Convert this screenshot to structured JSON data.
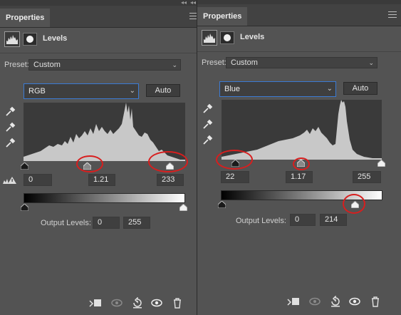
{
  "left_panel": {
    "tab_title": "Properties",
    "adjustment_title": "Levels",
    "preset_label": "Preset:",
    "preset_value": "Custom",
    "channel_value": "RGB",
    "auto_label": "Auto",
    "input_black": "0",
    "input_gamma": "1.21",
    "input_white": "233",
    "output_label": "Output Levels:",
    "output_black": "0",
    "output_white": "255"
  },
  "right_panel": {
    "tab_title": "Properties",
    "adjustment_title": "Levels",
    "preset_label": "Preset:",
    "preset_value": "Custom",
    "channel_value": "Blue",
    "auto_label": "Auto",
    "input_black": "22",
    "input_gamma": "1.17",
    "input_white": "255",
    "output_label": "Output Levels:",
    "output_black": "0",
    "output_white": "214"
  },
  "icons": [
    "collapse-arrows-icon",
    "panel-menu-icon",
    "levels-histogram-icon",
    "layer-mask-icon",
    "black-point-eyedropper-icon",
    "gray-point-eyedropper-icon",
    "white-point-eyedropper-icon",
    "clipping-warning-icon",
    "clip-to-layer-icon",
    "view-previous-state-icon",
    "reset-icon",
    "visibility-eye-icon",
    "trash-icon"
  ],
  "colors": {
    "panel_bg": "#535353",
    "focus_border": "#3b7bd4",
    "annotation_red": "#d81e1e",
    "histogram_fill": "#c8c8c8"
  },
  "levels": {
    "left": {
      "input_black": 0,
      "input_gamma": 1.21,
      "input_white": 233,
      "output_black": 0,
      "output_white": 255
    },
    "right": {
      "input_black": 22,
      "input_gamma": 1.17,
      "input_white": 255,
      "output_black": 0,
      "output_white": 214
    }
  }
}
